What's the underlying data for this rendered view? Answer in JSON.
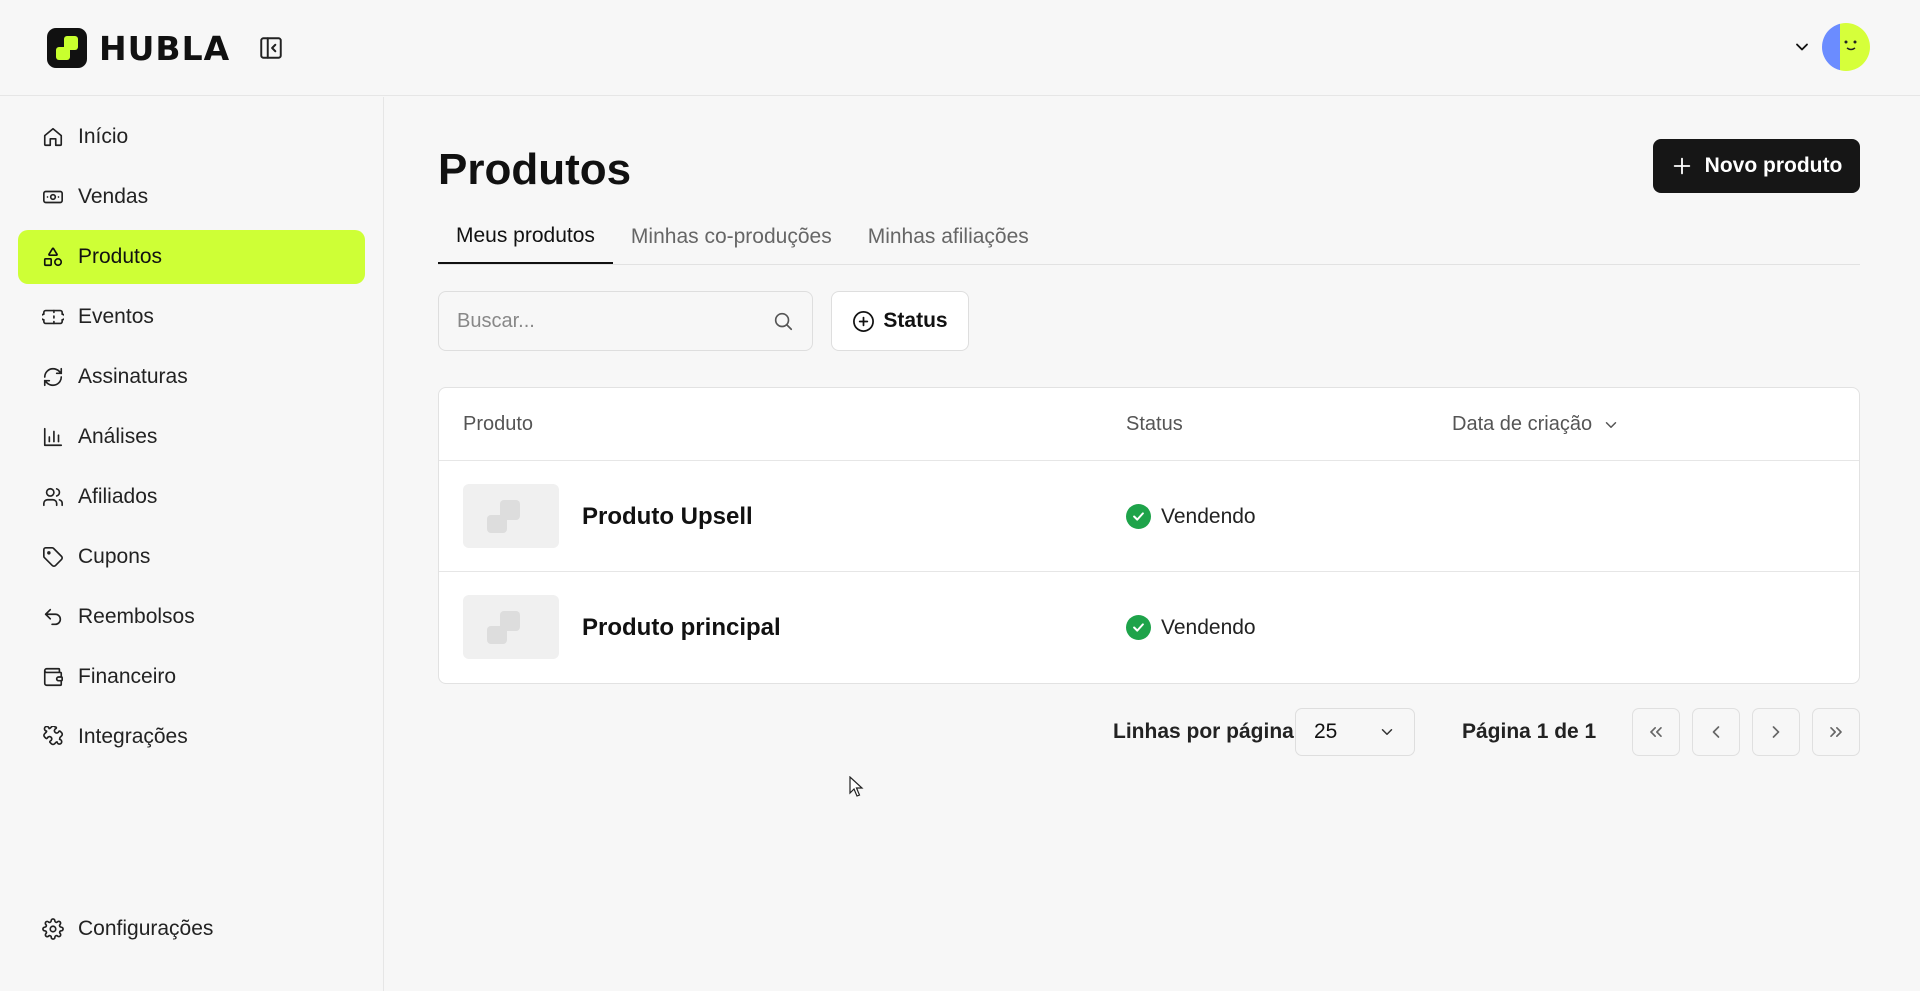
{
  "brand": {
    "name": "HUBLA",
    "accent": "#ceff36"
  },
  "sidebar": {
    "items": [
      {
        "label": "Início",
        "icon": "home-icon"
      },
      {
        "label": "Vendas",
        "icon": "money-icon"
      },
      {
        "label": "Produtos",
        "icon": "shapes-icon",
        "active": true
      },
      {
        "label": "Eventos",
        "icon": "ticket-icon"
      },
      {
        "label": "Assinaturas",
        "icon": "refresh-icon"
      },
      {
        "label": "Análises",
        "icon": "bar-chart-icon"
      },
      {
        "label": "Afiliados",
        "icon": "users-icon"
      },
      {
        "label": "Cupons",
        "icon": "tag-icon"
      },
      {
        "label": "Reembolsos",
        "icon": "undo-icon"
      },
      {
        "label": "Financeiro",
        "icon": "wallet-icon"
      },
      {
        "label": "Integrações",
        "icon": "puzzle-icon"
      }
    ],
    "settings_label": "Configurações"
  },
  "main": {
    "title": "Produtos",
    "new_button_label": "Novo produto",
    "tabs": [
      {
        "label": "Meus produtos",
        "active": true
      },
      {
        "label": "Minhas co-produções"
      },
      {
        "label": "Minhas afiliações"
      }
    ],
    "search": {
      "placeholder": "Buscar...",
      "value": ""
    },
    "status_filter_label": "Status",
    "table": {
      "columns": [
        "Produto",
        "Status",
        "Data de criação"
      ],
      "rows": [
        {
          "name": "Produto Upsell",
          "status": "Vendendo"
        },
        {
          "name": "Produto principal",
          "status": "Vendendo"
        }
      ]
    },
    "pagination": {
      "rows_per_page_label": "Linhas por página",
      "rows_per_page": "25",
      "page_info": "Página 1 de 1"
    }
  }
}
